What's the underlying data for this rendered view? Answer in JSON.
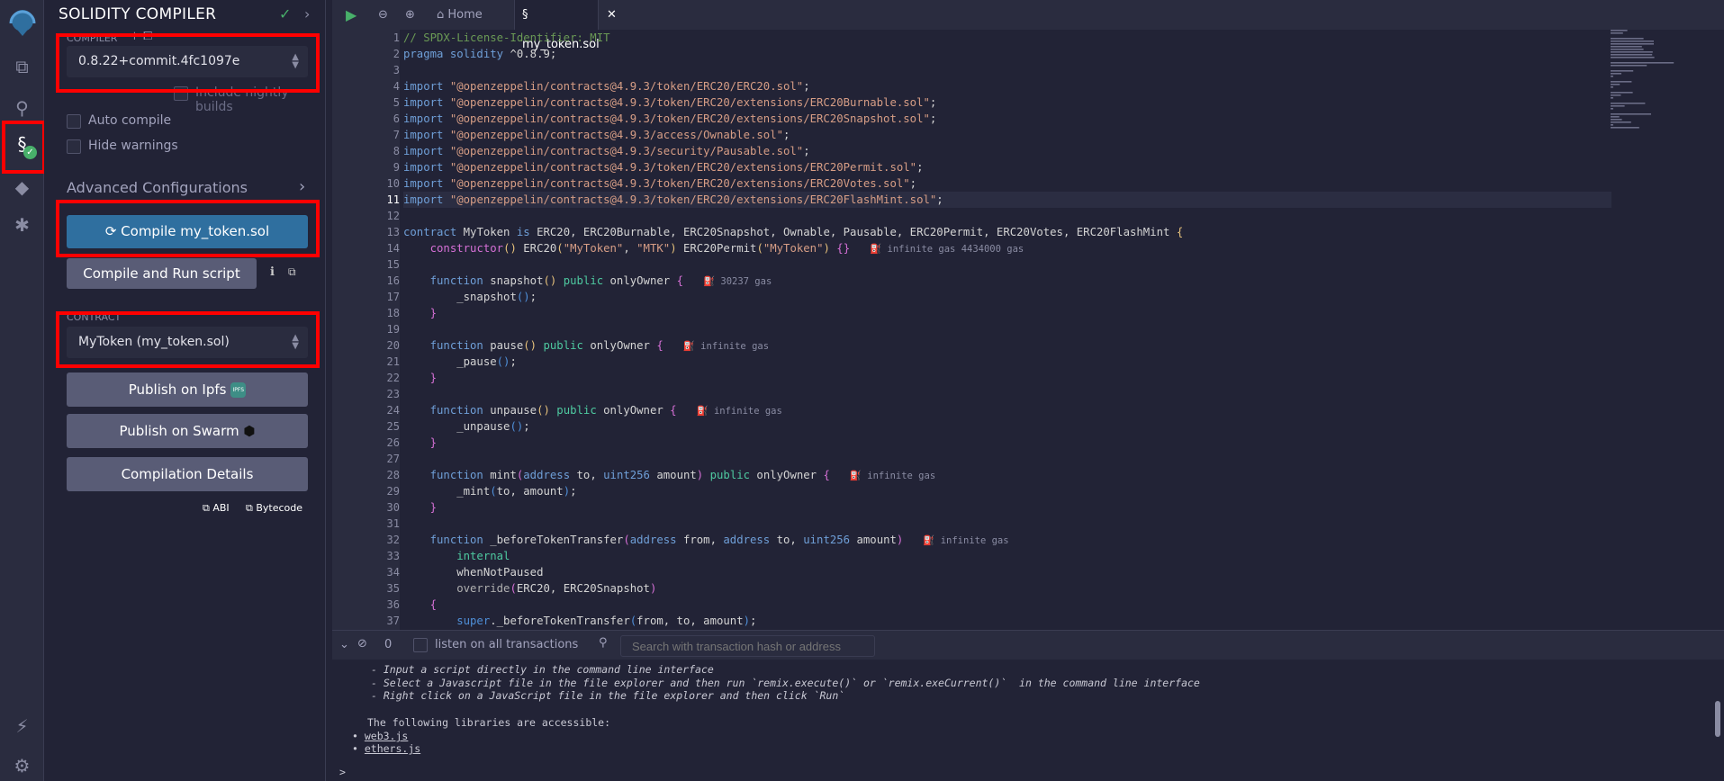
{
  "iconbar": {
    "icons": [
      "remix-logo-icon",
      "file-explorer-icon",
      "search-icon",
      "solidity-compiler-icon",
      "deploy-run-icon",
      "debugger-icon",
      "plugin-manager-icon",
      "settings-icon"
    ]
  },
  "panel": {
    "title": "SOLIDITY COMPILER",
    "compiler_label": "COMPILER",
    "compiler_version": "0.8.22+commit.4fc1097e",
    "nightly_label": "Include nightly builds",
    "auto_compile": "Auto compile",
    "hide_warnings": "Hide warnings",
    "advanced": "Advanced Configurations",
    "compile_button": "Compile my_token.sol",
    "compile_run_button": "Compile and Run script",
    "contract_label": "CONTRACT",
    "contract_value": "MyToken (my_token.sol)",
    "publish_ipfs": "Publish on Ipfs",
    "ipfs_badge": "IPFS",
    "publish_swarm": "Publish on Swarm",
    "compilation_details": "Compilation Details",
    "abi": "ABI",
    "bytecode": "Bytecode"
  },
  "tabs": {
    "home": "Home",
    "file": "my_token.sol"
  },
  "code": {
    "highlight_line": 11,
    "lines": [
      {
        "t": [
          [
            "c",
            "// SPDX-License-Identifier: MIT"
          ]
        ]
      },
      {
        "t": [
          [
            "k",
            "pragma solidity "
          ],
          [
            "t",
            "^0.8.9;"
          ]
        ]
      },
      {
        "t": []
      },
      {
        "t": [
          [
            "k",
            "import "
          ],
          [
            "s",
            "\"@openzeppelin/contracts@4.9.3/token/ERC20/ERC20.sol\""
          ],
          [
            "t",
            ";"
          ]
        ]
      },
      {
        "t": [
          [
            "k",
            "import "
          ],
          [
            "s",
            "\"@openzeppelin/contracts@4.9.3/token/ERC20/extensions/ERC20Burnable.sol\""
          ],
          [
            "t",
            ";"
          ]
        ]
      },
      {
        "t": [
          [
            "k",
            "import "
          ],
          [
            "s",
            "\"@openzeppelin/contracts@4.9.3/token/ERC20/extensions/ERC20Snapshot.sol\""
          ],
          [
            "t",
            ";"
          ]
        ]
      },
      {
        "t": [
          [
            "k",
            "import "
          ],
          [
            "s",
            "\"@openzeppelin/contracts@4.9.3/access/Ownable.sol\""
          ],
          [
            "t",
            ";"
          ]
        ]
      },
      {
        "t": [
          [
            "k",
            "import "
          ],
          [
            "s",
            "\"@openzeppelin/contracts@4.9.3/security/Pausable.sol\""
          ],
          [
            "t",
            ";"
          ]
        ]
      },
      {
        "t": [
          [
            "k",
            "import "
          ],
          [
            "s",
            "\"@openzeppelin/contracts@4.9.3/token/ERC20/extensions/ERC20Permit.sol\""
          ],
          [
            "t",
            ";"
          ]
        ]
      },
      {
        "t": [
          [
            "k",
            "import "
          ],
          [
            "s",
            "\"@openzeppelin/contracts@4.9.3/token/ERC20/extensions/ERC20Votes.sol\""
          ],
          [
            "t",
            ";"
          ]
        ]
      },
      {
        "t": [
          [
            "k",
            "import "
          ],
          [
            "s",
            "\"@openzeppelin/contracts@4.9.3/token/ERC20/extensions/ERC20FlashMint.sol\""
          ],
          [
            "t",
            ";"
          ]
        ]
      },
      {
        "t": []
      },
      {
        "t": [
          [
            "k",
            "contract "
          ],
          [
            "t",
            "MyToken "
          ],
          [
            "k",
            "is "
          ],
          [
            "t",
            "ERC20, ERC20Burnable, ERC20Snapshot, Ownable, Pausable, ERC20Permit, ERC20Votes, ERC20FlashMint "
          ],
          [
            "y",
            "{"
          ]
        ]
      },
      {
        "t": [
          [
            "t",
            "    "
          ],
          [
            "p",
            "constructor"
          ],
          [
            "y",
            "()"
          ],
          [
            "t",
            " ERC20"
          ],
          [
            "y",
            "("
          ],
          [
            "s",
            "\"MyToken\""
          ],
          [
            "t",
            ", "
          ],
          [
            "s",
            "\"MTK\""
          ],
          [
            "y",
            ")"
          ],
          [
            "t",
            " ERC20Permit"
          ],
          [
            "y",
            "("
          ],
          [
            "s",
            "\"MyToken\""
          ],
          [
            "y",
            ")"
          ],
          [
            "t",
            " "
          ],
          [
            "p",
            "{}"
          ]
        ],
        "gas": "infinite gas 4434000 gas"
      },
      {
        "t": []
      },
      {
        "t": [
          [
            "k",
            "    function "
          ],
          [
            "t",
            "snapshot"
          ],
          [
            "y",
            "()"
          ],
          [
            "t",
            " "
          ],
          [
            "g",
            "public"
          ],
          [
            "t",
            " onlyOwner "
          ],
          [
            "p",
            "{"
          ]
        ],
        "gas": "30237 gas"
      },
      {
        "t": [
          [
            "t",
            "        _snapshot"
          ],
          [
            "b",
            "()"
          ],
          [
            "t",
            ";"
          ]
        ]
      },
      {
        "t": [
          [
            "p",
            "    }"
          ]
        ]
      },
      {
        "t": []
      },
      {
        "t": [
          [
            "k",
            "    function "
          ],
          [
            "t",
            "pause"
          ],
          [
            "y",
            "()"
          ],
          [
            "t",
            " "
          ],
          [
            "g",
            "public"
          ],
          [
            "t",
            " onlyOwner "
          ],
          [
            "p",
            "{"
          ]
        ],
        "gas": "infinite gas"
      },
      {
        "t": [
          [
            "t",
            "        _pause"
          ],
          [
            "b",
            "()"
          ],
          [
            "t",
            ";"
          ]
        ]
      },
      {
        "t": [
          [
            "p",
            "    }"
          ]
        ]
      },
      {
        "t": []
      },
      {
        "t": [
          [
            "k",
            "    function "
          ],
          [
            "t",
            "unpause"
          ],
          [
            "y",
            "()"
          ],
          [
            "t",
            " "
          ],
          [
            "g",
            "public"
          ],
          [
            "t",
            " onlyOwner "
          ],
          [
            "p",
            "{"
          ]
        ],
        "gas": "infinite gas"
      },
      {
        "t": [
          [
            "t",
            "        _unpause"
          ],
          [
            "b",
            "()"
          ],
          [
            "t",
            ";"
          ]
        ]
      },
      {
        "t": [
          [
            "p",
            "    }"
          ]
        ]
      },
      {
        "t": []
      },
      {
        "t": [
          [
            "k",
            "    function "
          ],
          [
            "t",
            "mint"
          ],
          [
            "p",
            "("
          ],
          [
            "k",
            "address"
          ],
          [
            "t",
            " to, "
          ],
          [
            "k",
            "uint256"
          ],
          [
            "t",
            " amount"
          ],
          [
            "p",
            ")"
          ],
          [
            "t",
            " "
          ],
          [
            "g",
            "public"
          ],
          [
            "t",
            " onlyOwner "
          ],
          [
            "p",
            "{"
          ]
        ],
        "gas": "infinite gas"
      },
      {
        "t": [
          [
            "t",
            "        _mint"
          ],
          [
            "b",
            "("
          ],
          [
            "t",
            "to, amount"
          ],
          [
            "b",
            ")"
          ],
          [
            "t",
            ";"
          ]
        ]
      },
      {
        "t": [
          [
            "p",
            "    }"
          ]
        ]
      },
      {
        "t": []
      },
      {
        "t": [
          [
            "k",
            "    function "
          ],
          [
            "t",
            "_beforeTokenTransfer"
          ],
          [
            "p",
            "("
          ],
          [
            "k",
            "address"
          ],
          [
            "t",
            " from, "
          ],
          [
            "k",
            "address"
          ],
          [
            "t",
            " to, "
          ],
          [
            "k",
            "uint256"
          ],
          [
            "t",
            " amount"
          ],
          [
            "p",
            ")"
          ]
        ],
        "gas": "infinite gas"
      },
      {
        "t": [
          [
            "g",
            "        internal"
          ]
        ]
      },
      {
        "t": [
          [
            "t",
            "        whenNotPaused"
          ]
        ]
      },
      {
        "t": [
          [
            "o",
            "        override"
          ],
          [
            "p",
            "("
          ],
          [
            "t",
            "ERC20, ERC20Snapshot"
          ],
          [
            "p",
            ")"
          ]
        ]
      },
      {
        "t": [
          [
            "p",
            "    {"
          ]
        ]
      },
      {
        "t": [
          [
            "b",
            "        super"
          ],
          [
            "t",
            "._beforeTokenTransfer"
          ],
          [
            "b",
            "("
          ],
          [
            "t",
            "from, to, amount"
          ],
          [
            "b",
            ")"
          ],
          [
            "t",
            ";"
          ]
        ]
      }
    ]
  },
  "terminal": {
    "count": "0",
    "listen_label": "listen on all transactions",
    "search_placeholder": "Search with transaction hash or address",
    "lines": [
      "- Input a script directly in the command line interface",
      "- Select a Javascript file in the file explorer and then run `remix.execute()` or `remix.exeCurrent()`  in the command line interface",
      "- Right click on a JavaScript file in the file explorer and then click `Run`"
    ],
    "libraries_heading": "The following libraries are accessible:",
    "libraries": [
      "web3.js",
      "ethers.js"
    ],
    "prompt": ">"
  },
  "colors": {
    "accent": "#2f6f9f",
    "highlight": "#ff0000",
    "success": "#48b06a"
  }
}
